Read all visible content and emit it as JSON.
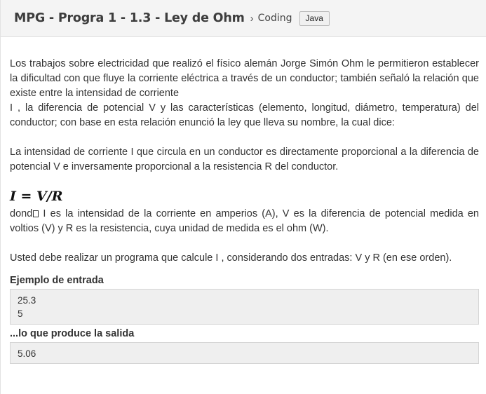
{
  "header": {
    "title": "MPG - Progra 1 - 1.3 - Ley de Ohm",
    "separator": "›",
    "breadcrumb": "Coding",
    "language_badge": "Java"
  },
  "statement": {
    "paragraph1_line1": "Los trabajos sobre electricidad que realizó el físico alemán Jorge Simón Ohm le permitieron establecer la dificultad con que fluye la corriente eléctrica a través de un conductor; también señaló la relación que existe entre la intensidad de corriente",
    "paragraph1_line2": "I , la diferencia de potencial V y las características (elemento, longitud, diámetro, temperatura) del conductor; con base en esta relación enunció la ley que lleva su nombre, la cual dice:",
    "paragraph2": "La intensidad de corriente I que circula en un conductor es directamente proporcional a la diferencia de potencial V e inversamente proporcional a la resistencia R del conductor.",
    "formula": "I = V/R",
    "paragraph3_start": "dond",
    "paragraph3_rest": " I es la intensidad de la corriente en amperios (A), V es la diferencia de potencial medida en voltios (V) y R es la resistencia, cuya unidad de medida es el ohm (W).",
    "paragraph4": "Usted debe realizar un programa que calcule I , considerando dos entradas: V  y R (en ese orden)."
  },
  "example": {
    "input_label": "Ejemplo de entrada",
    "input_value": "25.3\n5",
    "output_label": "...lo que produce la salida",
    "output_value": "5.06"
  }
}
